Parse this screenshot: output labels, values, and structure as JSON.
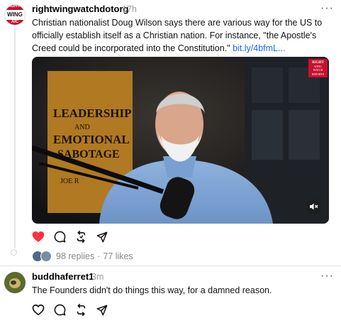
{
  "post": {
    "username": "rightwingwatchdotorg",
    "time": "17h",
    "text": "Christian nationalist Doug Wilson says there are various way for the US to officially establish itself as a Christian nation. For instance, \"the Apostle's Creed could be incorporated into the Constitution.\" ",
    "link": "bit.ly/4bfmL...",
    "avatar_text": [
      "IGHT",
      "WING",
      "AIC"
    ],
    "video": {
      "badge": [
        "RIGHT",
        "WING",
        "WATCH",
        "REPORTS"
      ],
      "book_title": [
        "LEADERSHIP",
        "AND",
        "EMOTIONAL",
        "SABOTAGE"
      ],
      "book_author": "JOE R",
      "mute_icon": "mute-icon"
    },
    "liked": true,
    "replies": "98 replies",
    "likes": "77 likes",
    "separator": "·"
  },
  "reply": {
    "username": "buddhaferret1",
    "time": "3m",
    "text": "The Founders didn't do things this way, for a damned reason."
  },
  "colors": {
    "like_red": "#ff3040",
    "link_blue": "#1c6ae4",
    "muted_gray": "#999999"
  },
  "icons": [
    "heart-icon",
    "comment-icon",
    "repost-icon",
    "share-icon",
    "more-icon"
  ]
}
